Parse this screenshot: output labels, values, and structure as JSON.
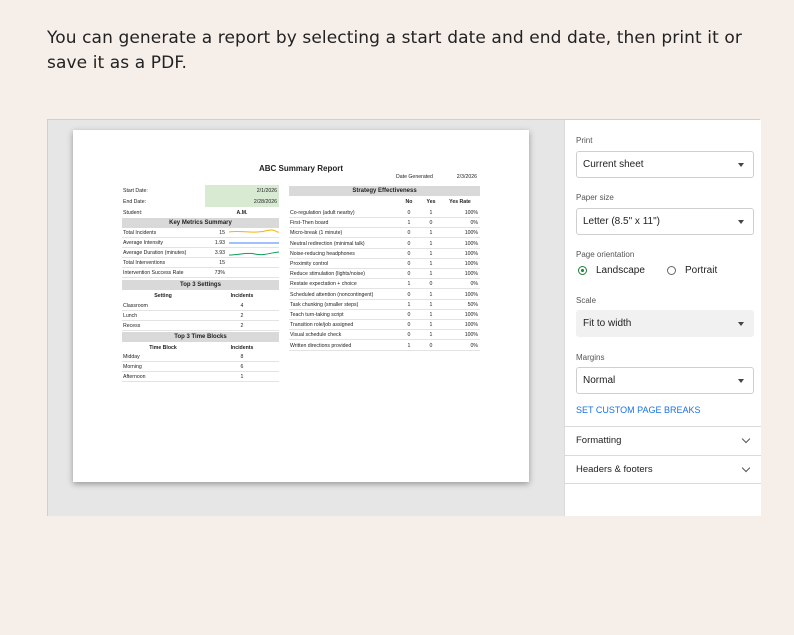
{
  "intro_text": "You can generate a report by selecting a start date and end date, then print it or save it as a PDF.",
  "report": {
    "title": "ABC Summary Report",
    "date_generated_label": "Date Generated",
    "date_generated": "2/3/2026",
    "start_date_label": "Start Date:",
    "start_date": "2/1/2026",
    "end_date_label": "End Date:",
    "end_date": "2/28/2026",
    "student_label": "Student:",
    "student": "A.M.",
    "key_metrics_header": "Key Metrics Summary",
    "metrics": [
      {
        "label": "Total Incidents",
        "value": "15"
      },
      {
        "label": "Average Intensity",
        "value": "1.93"
      },
      {
        "label": "Average Duration (minutes)",
        "value": "3.93"
      },
      {
        "label": "Total Interventions",
        "value": "15"
      },
      {
        "label": "Intervention Success Rate",
        "value": "73%"
      }
    ],
    "sparkline_colors": [
      "#f4b400",
      "#4285f4",
      "#0f9d58"
    ],
    "settings_header": "Top 3 Settings",
    "settings_col1": "Setting",
    "settings_col2": "Incidents",
    "settings": [
      {
        "name": "Classroom",
        "value": "4"
      },
      {
        "name": "Lunch",
        "value": "2"
      },
      {
        "name": "Recess",
        "value": "2"
      }
    ],
    "timeblocks_header": "Top 3 Time Blocks",
    "timeblocks_col1": "Time Block",
    "timeblocks_col2": "Incidents",
    "timeblocks": [
      {
        "name": "Midday",
        "value": "8"
      },
      {
        "name": "Morning",
        "value": "6"
      },
      {
        "name": "Afternoon",
        "value": "1"
      }
    ],
    "strategy_header": "Strategy Effectiveness",
    "strategy_cols": [
      "No",
      "Yes",
      "Yes Rate"
    ],
    "strategies": [
      {
        "name": "Co-regulation (adult nearby)",
        "no": "0",
        "yes": "1",
        "rate": "100%"
      },
      {
        "name": "First-Then board",
        "no": "1",
        "yes": "0",
        "rate": "0%"
      },
      {
        "name": "Micro-break (1 minute)",
        "no": "0",
        "yes": "1",
        "rate": "100%"
      },
      {
        "name": "Neutral redirection (minimal talk)",
        "no": "0",
        "yes": "1",
        "rate": "100%"
      },
      {
        "name": "Noise-reducing headphones",
        "no": "0",
        "yes": "1",
        "rate": "100%"
      },
      {
        "name": "Proximity control",
        "no": "0",
        "yes": "1",
        "rate": "100%"
      },
      {
        "name": "Reduce stimulation (lights/noise)",
        "no": "0",
        "yes": "1",
        "rate": "100%"
      },
      {
        "name": "Restate expectation + choice",
        "no": "1",
        "yes": "0",
        "rate": "0%"
      },
      {
        "name": "Scheduled attention (noncontingent)",
        "no": "0",
        "yes": "1",
        "rate": "100%"
      },
      {
        "name": "Task chunking (smaller steps)",
        "no": "1",
        "yes": "1",
        "rate": "50%"
      },
      {
        "name": "Teach turn-taking script",
        "no": "0",
        "yes": "1",
        "rate": "100%"
      },
      {
        "name": "Transition role/job assigned",
        "no": "0",
        "yes": "1",
        "rate": "100%"
      },
      {
        "name": "Visual schedule check",
        "no": "0",
        "yes": "1",
        "rate": "100%"
      },
      {
        "name": "Written directions provided",
        "no": "1",
        "yes": "0",
        "rate": "0%"
      }
    ]
  },
  "print_panel": {
    "print_label": "Print",
    "print_value": "Current sheet",
    "paper_size_label": "Paper size",
    "paper_size_value": "Letter (8.5\" x 11\")",
    "orientation_label": "Page orientation",
    "orientation_landscape": "Landscape",
    "orientation_portrait": "Portrait",
    "orientation_selected": "Landscape",
    "scale_label": "Scale",
    "scale_value": "Fit to width",
    "margins_label": "Margins",
    "margins_value": "Normal",
    "page_breaks_link": "SET CUSTOM PAGE BREAKS",
    "formatting_label": "Formatting",
    "headers_footers_label": "Headers & footers",
    "accent_color": "#1a73e8",
    "radio_color": "#188038"
  }
}
